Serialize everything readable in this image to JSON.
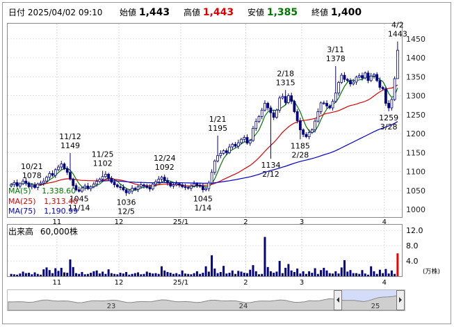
{
  "header": {
    "date_label": "日付",
    "datetime": "2025/04/02 09:10",
    "open_label": "始値",
    "open": "1,443",
    "high_label": "高値",
    "high": "1,443",
    "low_label": "安値",
    "low": "1,385",
    "close_label": "終値",
    "close": "1,400"
  },
  "legend": [
    {
      "label": "MA(5)",
      "value": "1,338.60",
      "color": "#007700"
    },
    {
      "label": "MA(25)",
      "value": "1,313.40",
      "color": "#dd0000"
    },
    {
      "label": "MA(75)",
      "value": "1,190.99",
      "color": "#0000cc"
    }
  ],
  "volume_panel": {
    "title": "出来高",
    "unit_label": "60,000株",
    "axis_unit": "(万株)",
    "ticks": [
      "12.0",
      "8.0",
      "4.0"
    ]
  },
  "colors": {
    "candle": "#000080",
    "ma5": "#007700",
    "ma25": "#dd0000",
    "ma75": "#0000cc",
    "volume": "#000080",
    "volume_last": "#ee0000"
  },
  "chart_data": {
    "type": "candlestick",
    "y_ticks": [
      1000,
      1050,
      1100,
      1150,
      1200,
      1250,
      1300,
      1350,
      1400,
      1450
    ],
    "ylim": [
      980,
      1490
    ],
    "x_month_labels": [
      "11",
      "12",
      "25/1",
      "2",
      "3",
      "4"
    ],
    "annotations": [
      {
        "date": "10/21",
        "price": "1078",
        "pos": "above"
      },
      {
        "date": "11/12",
        "price": "1149",
        "pos": "above"
      },
      {
        "date": "11/14",
        "price": "1045",
        "pos": "below"
      },
      {
        "date": "11/25",
        "price": "1102",
        "pos": "above"
      },
      {
        "date": "12/5",
        "price": "1036",
        "pos": "below"
      },
      {
        "date": "12/24",
        "price": "1092",
        "pos": "above"
      },
      {
        "date": "1/14",
        "price": "1045",
        "pos": "below"
      },
      {
        "date": "1/21",
        "price": "1195",
        "pos": "above"
      },
      {
        "date": "2/12",
        "price": "1134",
        "pos": "below"
      },
      {
        "date": "2/18",
        "price": "1315",
        "pos": "above"
      },
      {
        "date": "2/28",
        "price": "1185",
        "pos": "below"
      },
      {
        "date": "3/11",
        "price": "1378",
        "pos": "above"
      },
      {
        "date": "3/28",
        "price": "1259",
        "pos": "below"
      },
      {
        "date": "4/2",
        "price": "1443",
        "pos": "above"
      }
    ],
    "closes": [
      1066,
      1071,
      1062,
      1068,
      1075,
      1070,
      1060,
      1064,
      1058,
      1067,
      1070,
      1075,
      1085,
      1095,
      1090,
      1105,
      1112,
      1120,
      1108,
      1098,
      1080,
      1063,
      1052,
      1048,
      1057,
      1062,
      1055,
      1060,
      1067,
      1074,
      1080,
      1087,
      1093,
      1082,
      1072,
      1065,
      1060,
      1058,
      1052,
      1044,
      1048,
      1056,
      1053,
      1060,
      1065,
      1062,
      1058,
      1054,
      1067,
      1073,
      1080,
      1085,
      1076,
      1070,
      1062,
      1065,
      1068,
      1065,
      1060,
      1058,
      1056,
      1062,
      1068,
      1064,
      1061,
      1052,
      1055,
      1070,
      1098,
      1128,
      1142,
      1148,
      1155,
      1150,
      1165,
      1172,
      1167,
      1176,
      1185,
      1190,
      1175,
      1182,
      1214,
      1232,
      1245,
      1262,
      1280,
      1268,
      1255,
      1243,
      1262,
      1294,
      1298,
      1282,
      1300,
      1285,
      1258,
      1234,
      1210,
      1198,
      1192,
      1203,
      1210,
      1233,
      1258,
      1281,
      1280,
      1273,
      1268,
      1285,
      1307,
      1335,
      1354,
      1343,
      1340,
      1331,
      1336,
      1349,
      1353,
      1347,
      1360,
      1340,
      1352,
      1356,
      1340,
      1322,
      1318,
      1280,
      1268,
      1290,
      1345,
      1420
    ],
    "volumes": [
      0.6,
      0.5,
      0.4,
      0.7,
      1.2,
      0.8,
      0.9,
      0.5,
      1.0,
      0.6,
      0.4,
      1.8,
      2.3,
      1.6,
      0.8,
      2.1,
      1.4,
      2.2,
      1.0,
      0.9,
      4.4,
      2.4,
      0.8,
      0.6,
      1.1,
      0.5,
      0.6,
      0.9,
      1.3,
      1.5,
      0.7,
      1.2,
      0.6,
      1.8,
      0.8,
      0.6,
      0.5,
      0.9,
      0.7,
      1.1,
      0.4,
      0.6,
      0.8,
      1.0,
      0.5,
      0.6,
      1.2,
      0.9,
      0.7,
      0.8,
      0.6,
      2.6,
      1.5,
      1.1,
      0.9,
      0.6,
      0.8,
      0.5,
      1.5,
      0.7,
      0.6,
      0.5,
      0.8,
      1.3,
      0.6,
      0.9,
      2.6,
      1.2,
      5.5,
      2.0,
      0.8,
      1.1,
      2.7,
      0.7,
      0.9,
      1.5,
      0.6,
      1.4,
      1.2,
      0.9,
      0.8,
      1.7,
      2.9,
      1.3,
      0.5,
      0.6,
      10.3,
      2.4,
      1.3,
      0.9,
      1.2,
      4.0,
      0.8,
      2.2,
      3.2,
      1.5,
      1.1,
      2.0,
      0.7,
      1.3,
      0.6,
      1.3,
      0.9,
      2.1,
      0.6,
      1.6,
      2.2,
      1.5,
      0.8,
      0.7,
      1.3,
      0.7,
      2.3,
      4.2,
      1.2,
      1.6,
      0.8,
      0.8,
      0.6,
      1.6,
      0.7,
      0.4,
      2.6,
      1.3,
      0.6,
      1.7,
      0.8,
      1.9,
      0.7,
      1.5,
      0.6,
      6.0
    ],
    "volume_ylim": [
      0,
      13.5
    ],
    "overview_labels": [
      "23",
      "24",
      "25"
    ]
  }
}
